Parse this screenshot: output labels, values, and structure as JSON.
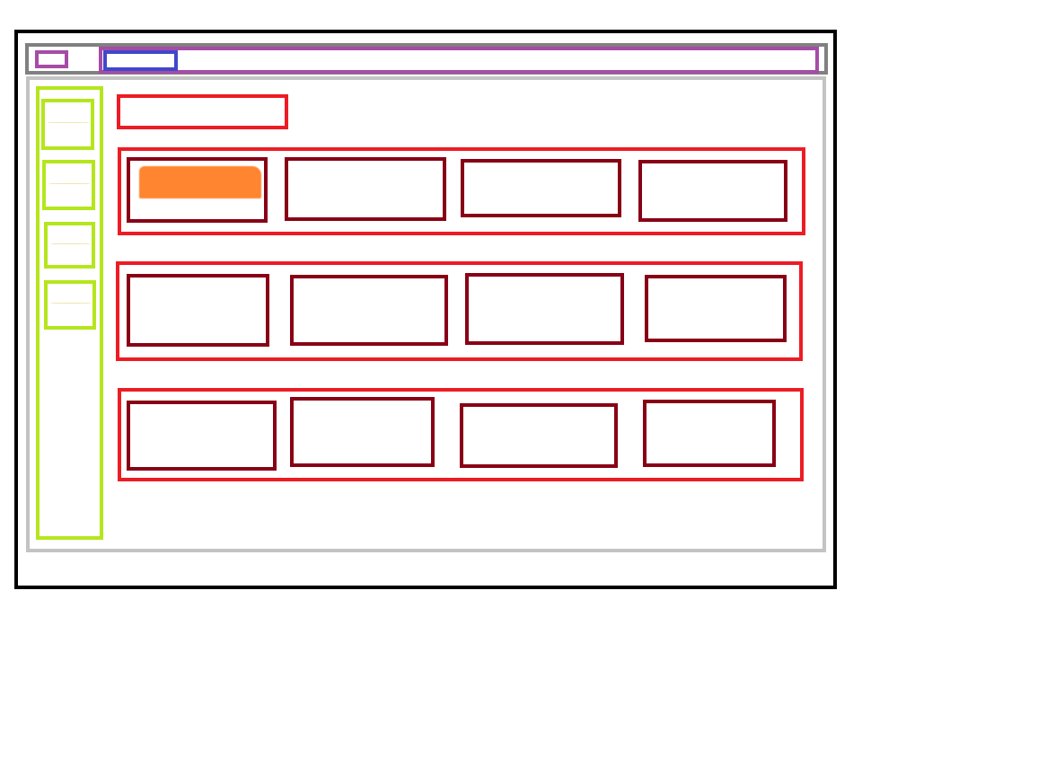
{
  "colors": {
    "frame": "#000000",
    "topbar": "#808080",
    "purple": "#a64ca6",
    "blue": "#3f48cc",
    "content": "#c3c3c3",
    "sidebar": "#b5e61d",
    "section": "#ed1c24",
    "card": "#880015",
    "accent": "#ff7f27",
    "line": "#efe4b0"
  }
}
